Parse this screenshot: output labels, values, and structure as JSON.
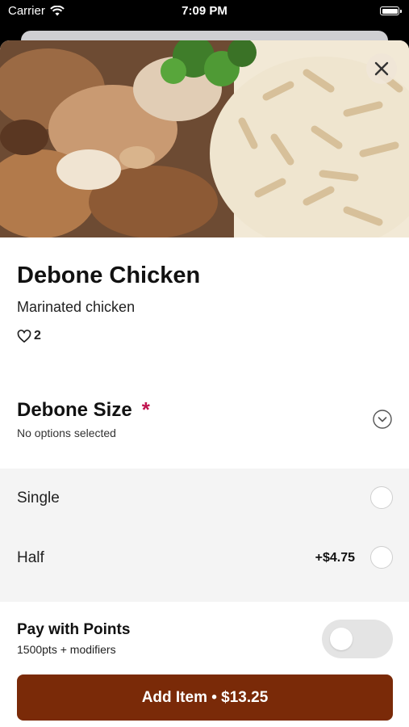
{
  "status_bar": {
    "carrier": "Carrier",
    "time": "7:09 PM"
  },
  "item": {
    "name": "Debone Chicken",
    "description": "Marinated chicken",
    "likes": "2"
  },
  "modifier_group": {
    "title": "Debone Size",
    "required_marker": "*",
    "status": "No options selected",
    "options": [
      {
        "label": "Single",
        "price": ""
      },
      {
        "label": "Half",
        "price": "+$4.75"
      }
    ]
  },
  "points": {
    "title": "Pay with Points",
    "subtitle": "1500pts + modifiers",
    "enabled": false
  },
  "cta": {
    "label": "Add Item • $13.25"
  },
  "colors": {
    "accent": "#7a2a08",
    "required": "#c0134e",
    "options_background": "#f4f4f4"
  },
  "icons": [
    "wifi-icon",
    "battery-icon",
    "close-icon",
    "heart-icon",
    "chevron-down-icon"
  ]
}
